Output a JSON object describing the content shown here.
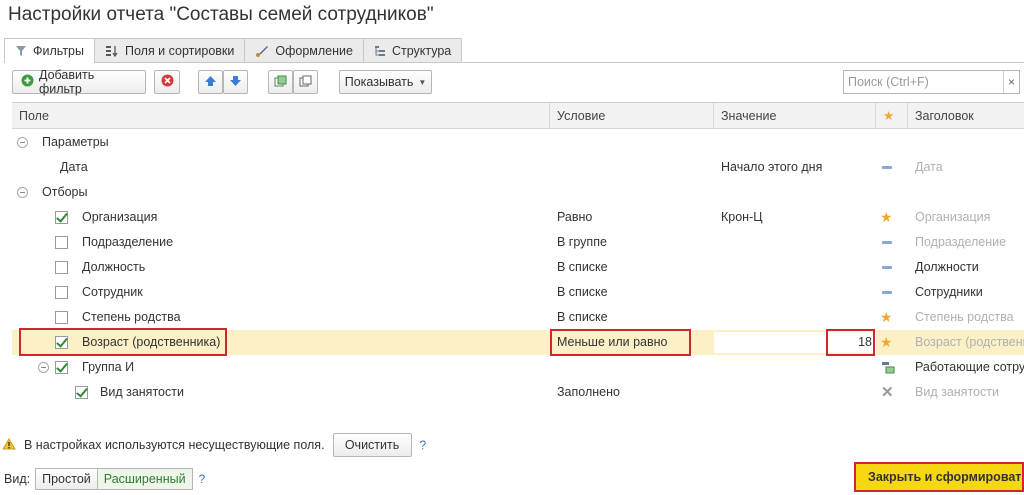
{
  "window": {
    "title": "Настройки отчета \"Составы семей сотрудников\""
  },
  "tabs": [
    {
      "label": "Фильтры",
      "icon": "filter-icon",
      "active": true
    },
    {
      "label": "Поля и сортировки",
      "icon": "fields-icon",
      "active": false
    },
    {
      "label": "Оформление",
      "icon": "brush-icon",
      "active": false
    },
    {
      "label": "Структура",
      "icon": "structure-icon",
      "active": false
    }
  ],
  "toolbar": {
    "add_filter_label": "Добавить фильтр",
    "show_label": "Показывать",
    "search_placeholder": "Поиск (Ctrl+F)",
    "search_clear": "×"
  },
  "columns": {
    "field": "Поле",
    "condition": "Условие",
    "value": "Значение",
    "star": "★",
    "header": "Заголовок"
  },
  "rows": [
    {
      "type": "group",
      "field": "Параметры",
      "condition": "",
      "value": "",
      "mark": "",
      "header": ""
    },
    {
      "type": "param",
      "field": "Дата",
      "condition": "",
      "value": "Начало этого дня",
      "mark": "dash",
      "header": "Дата"
    },
    {
      "type": "group",
      "field": "Отборы",
      "condition": "",
      "value": "",
      "mark": "",
      "header": ""
    },
    {
      "type": "filter",
      "checked": true,
      "field": "Организация",
      "condition": "Равно",
      "value": "Крон-Ц",
      "mark": "star",
      "header": "Организация",
      "header_muted": true
    },
    {
      "type": "filter",
      "checked": false,
      "field": "Подразделение",
      "condition": "В группе",
      "value": "",
      "mark": "dash",
      "header": "Подразделение",
      "header_muted": true
    },
    {
      "type": "filter",
      "checked": false,
      "field": "Должность",
      "condition": "В списке",
      "value": "",
      "mark": "dash",
      "header": "Должности",
      "header_muted": false
    },
    {
      "type": "filter",
      "checked": false,
      "field": "Сотрудник",
      "condition": "В списке",
      "value": "",
      "mark": "dash",
      "header": "Сотрудники",
      "header_muted": false
    },
    {
      "type": "filter",
      "checked": false,
      "field": "Степень родства",
      "condition": "В списке",
      "value": "",
      "mark": "star",
      "header": "Степень родства",
      "header_muted": true
    },
    {
      "type": "filter",
      "checked": true,
      "field": "Возраст (родственника)",
      "condition": "Меньше или равно",
      "value": "18",
      "mark": "star",
      "header": "Возраст (родственника)",
      "header_muted": true,
      "selected": true
    },
    {
      "type": "subgroup",
      "checked": true,
      "field": "Группа И",
      "condition": "",
      "value": "",
      "mark": "group",
      "header": "Работающие сотрудники",
      "header_muted": false
    },
    {
      "type": "subfilter",
      "checked": true,
      "field": "Вид занятости",
      "condition": "Заполнено",
      "value": "",
      "mark": "x",
      "header": "Вид занятости",
      "header_muted": true
    }
  ],
  "footer": {
    "warning": "В настройках используются несуществующие поля.",
    "clear_label": "Очистить",
    "help": "?",
    "view_label": "Вид:",
    "view_simple": "Простой",
    "view_extended": "Расширенный",
    "primary_label": "Закрыть и сформировать"
  },
  "colors": {
    "selected_row": "#fbf0c6",
    "highlight_border": "#d0262d",
    "primary_button": "#f6d812",
    "check": "#2e8b3a",
    "star": "#f0a830"
  }
}
